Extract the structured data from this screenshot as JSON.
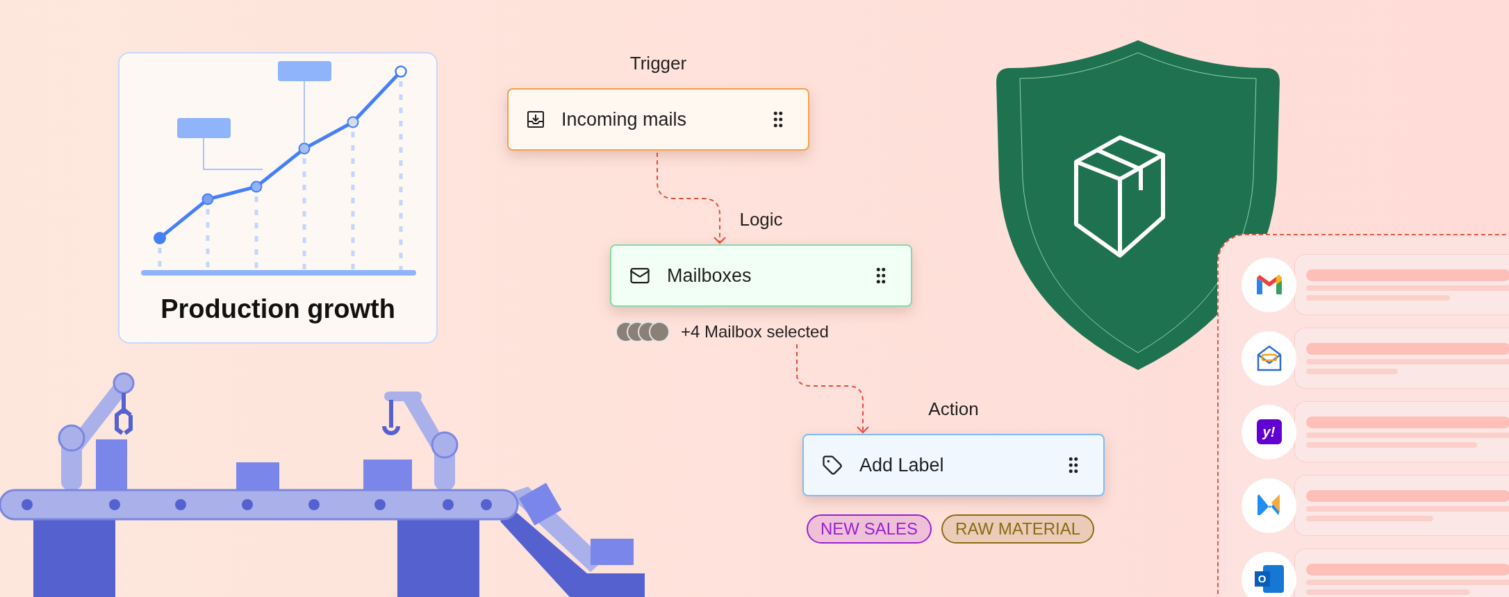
{
  "chart_card": {
    "title": "Production growth"
  },
  "steps": [
    {
      "kind": "trigger",
      "heading": "Trigger",
      "label": "Incoming mails",
      "color": "#f5a04a"
    },
    {
      "kind": "logic",
      "heading": "Logic",
      "label": "Mailboxes",
      "color": "#86d9a8",
      "selection": "+4 Mailbox selected"
    },
    {
      "kind": "action",
      "heading": "Action",
      "label": "Add Label",
      "color": "#7cbcf7",
      "tags": [
        {
          "label": "NEW SALES",
          "color": "#9b1fd0"
        },
        {
          "label": "RAW MATERIAL",
          "color": "#8a6a14"
        }
      ]
    }
  ],
  "providers": [
    {
      "kind": "m"
    },
    {
      "kind": "envelope"
    },
    {
      "kind": "square",
      "logo_text": "y!"
    },
    {
      "kind": "k"
    },
    {
      "kind": "o",
      "logo_text": "O"
    }
  ]
}
